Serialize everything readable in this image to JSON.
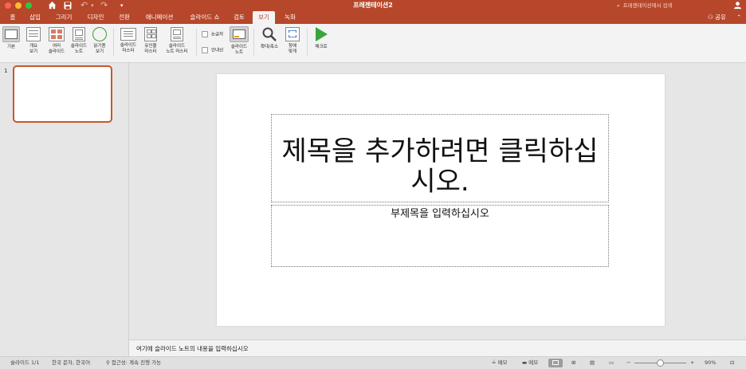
{
  "window": {
    "title": "프레젠테이션2",
    "search_placeholder": "프레젠테이션에서 검색",
    "traffic_colors": [
      "#ff5f57",
      "#febc2e",
      "#28c840"
    ]
  },
  "quick_access": {
    "home_icon": "home-icon",
    "save_icon": "save-icon",
    "undo_icon": "undo-icon",
    "redo_icon": "redo-icon",
    "customize_icon": "customize-icon"
  },
  "tabs": [
    "홈",
    "삽입",
    "그리기",
    "디자인",
    "전환",
    "애니메이션",
    "슬라이드 쇼",
    "검토",
    "보기",
    "녹화"
  ],
  "active_tab": "보기",
  "share_label": "공유",
  "ribbon": {
    "views": [
      {
        "line1": "기본",
        "line2": "",
        "icon": "normal-view-icon"
      },
      {
        "line1": "개요",
        "line2": "보기",
        "icon": "outline-view-icon"
      },
      {
        "line1": "여러",
        "line2": "슬라이드",
        "icon": "slide-sorter-icon"
      },
      {
        "line1": "슬라이드",
        "line2": "노트",
        "icon": "notes-page-icon"
      },
      {
        "line1": "읽기용",
        "line2": "보기",
        "icon": "reading-view-icon"
      }
    ],
    "masters": [
      {
        "line1": "슬라이드",
        "line2": "마스터",
        "icon": "slide-master-icon"
      },
      {
        "line1": "유인물",
        "line2": "마스터",
        "icon": "handout-master-icon"
      },
      {
        "line1": "슬라이드",
        "line2": "노트 마스터",
        "icon": "notes-master-icon"
      }
    ],
    "ruler_label": "눈금자",
    "guides_label": "안내선",
    "slide_notes": {
      "line1": "슬라이드",
      "line2": "노트"
    },
    "zoom": {
      "line1": "확대/축소",
      "line2": ""
    },
    "fit_window": {
      "line1": "창에",
      "line2": "맞게"
    },
    "macro": {
      "line1": "매크로",
      "line2": ""
    }
  },
  "thumbnails": {
    "slide_number": "1"
  },
  "slide": {
    "title_placeholder": "제목을 추가하려면 클릭하십시오.",
    "subtitle_placeholder": "부제목을 입력하십시오"
  },
  "notes_placeholder": "여기에 슬라이드 노트의 내용을 입력하십시오",
  "status": {
    "slide_count": "슬라이드 1/1",
    "language": "한국 문자, 한국어",
    "accessibility": "접근성: 계속 진행 가능",
    "notes_button": "메모",
    "comments_button": "메모",
    "zoom_level": "90%",
    "zoom_fraction": 0.5
  },
  "colors": {
    "accent": "#b7472a",
    "selected_thumb_border": "#c4582e"
  }
}
